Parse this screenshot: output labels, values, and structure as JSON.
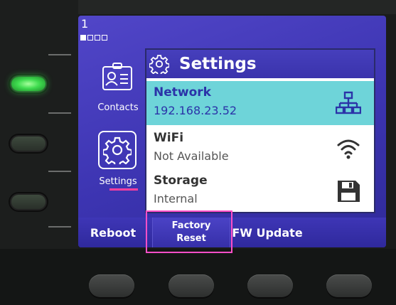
{
  "screen": {
    "line_number": "1",
    "page_dots": [
      true,
      false,
      false,
      false
    ]
  },
  "apps": [
    {
      "id": "contacts",
      "label": "Contacts",
      "icon": "contacts-card-icon"
    },
    {
      "id": "settings",
      "label": "Settings",
      "icon": "gear-icon",
      "selected": true
    }
  ],
  "settings_panel": {
    "title": "Settings",
    "rows": [
      {
        "title": "Network",
        "value": "192.168.23.52",
        "icon": "network-icon",
        "selected": true
      },
      {
        "title": "WiFi",
        "value": "Not Available",
        "icon": "wifi-icon",
        "selected": false
      },
      {
        "title": "Storage",
        "value": "Internal",
        "icon": "floppy-disk-icon",
        "selected": false
      }
    ]
  },
  "softkeys": {
    "reboot": "Reboot",
    "factory_reset": "Factory\nReset",
    "fw_update": "FW Update"
  },
  "colors": {
    "screen_bg": "#4a40c0",
    "selected_row": "#6ed4d9",
    "selected_text": "#2b33a8",
    "highlight": "#ff4fc8",
    "line_led": "#3fdc4f"
  }
}
